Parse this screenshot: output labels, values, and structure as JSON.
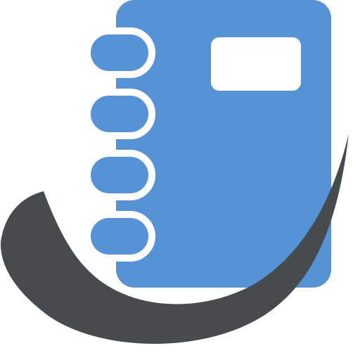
{
  "logo": {
    "icon": "spiral-notebook-icon",
    "swoosh_icon": "swoosh-icon",
    "colors": {
      "notebook": "#5593d6",
      "rings": "#5593d6",
      "label": "#ffffff",
      "swoosh": "#474b4e",
      "background": "#ffffff"
    },
    "ring_count": 4
  }
}
